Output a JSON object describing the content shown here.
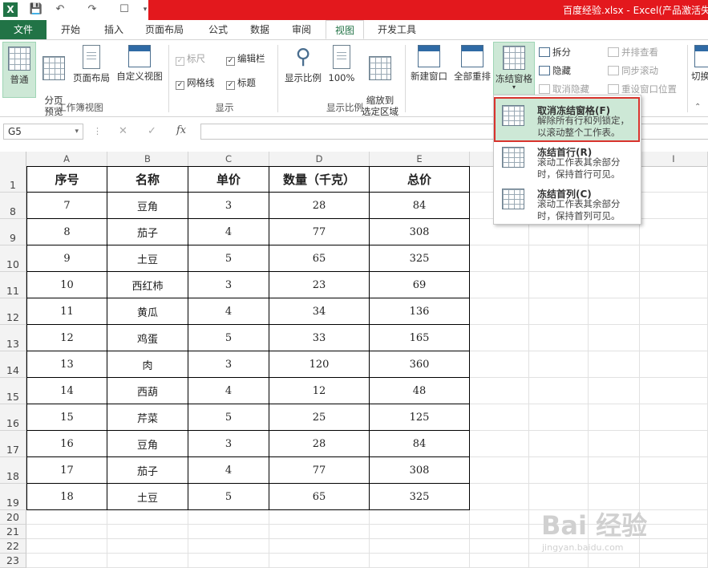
{
  "titlebar": {
    "title": "百度经验.xlsx - Excel(产品激活失",
    "app_icon": "X",
    "accent": "#e3181d"
  },
  "tabs": [
    "文件",
    "开始",
    "插入",
    "页面布局",
    "公式",
    "数据",
    "审阅",
    "视图",
    "开发工具"
  ],
  "active_tab": "视图",
  "ribbon": {
    "workbook_views": {
      "normal": "普通",
      "page_break": "分页\n预览",
      "page_layout": "页面布局",
      "custom_views": "自定义视图",
      "group": "工作簿视图"
    },
    "show": {
      "ruler": "标尺",
      "formula_bar": "编辑栏",
      "gridlines": "网格线",
      "headings": "标题",
      "group": "显示"
    },
    "zoom": {
      "zoom": "显示比例",
      "hundred": "100%",
      "to_selection": "缩放到\n选定区域",
      "group": "显示比例"
    },
    "window": {
      "new_window": "新建窗口",
      "arrange_all": "全部重排",
      "freeze_panes": "冻结窗格",
      "split": "拆分",
      "hide": "隐藏",
      "unhide": "取消隐藏",
      "side_by_side": "并排查看",
      "sync_scroll": "同步滚动",
      "reset_position": "重设窗口位置",
      "switch": "切换"
    }
  },
  "formula_bar": {
    "name_box": "G5",
    "cancel": "✕",
    "enter": "✓",
    "fx": "fx"
  },
  "columns": [
    "A",
    "B",
    "C",
    "D",
    "E",
    "I"
  ],
  "table": {
    "headers": [
      "序号",
      "名称",
      "单价",
      "数量（千克）",
      "总价"
    ],
    "rows": [
      {
        "row": "8",
        "cells": [
          "7",
          "豆角",
          "3",
          "28",
          "84"
        ]
      },
      {
        "row": "9",
        "cells": [
          "8",
          "茄子",
          "4",
          "77",
          "308"
        ]
      },
      {
        "row": "10",
        "cells": [
          "9",
          "土豆",
          "5",
          "65",
          "325"
        ]
      },
      {
        "row": "11",
        "cells": [
          "10",
          "西红柿",
          "3",
          "23",
          "69"
        ]
      },
      {
        "row": "12",
        "cells": [
          "11",
          "黄瓜",
          "4",
          "34",
          "136"
        ]
      },
      {
        "row": "13",
        "cells": [
          "12",
          "鸡蛋",
          "5",
          "33",
          "165"
        ]
      },
      {
        "row": "14",
        "cells": [
          "13",
          "肉",
          "3",
          "120",
          "360"
        ]
      },
      {
        "row": "15",
        "cells": [
          "14",
          "西葫",
          "4",
          "12",
          "48"
        ]
      },
      {
        "row": "16",
        "cells": [
          "15",
          "芹菜",
          "5",
          "25",
          "125"
        ]
      },
      {
        "row": "17",
        "cells": [
          "16",
          "豆角",
          "3",
          "28",
          "84"
        ]
      },
      {
        "row": "18",
        "cells": [
          "17",
          "茄子",
          "4",
          "77",
          "308"
        ]
      },
      {
        "row": "19",
        "cells": [
          "18",
          "土豆",
          "5",
          "65",
          "325"
        ]
      }
    ],
    "header_row": "1",
    "empty_rows": [
      "20",
      "21",
      "22",
      "23"
    ]
  },
  "freeze_menu": [
    {
      "title": "取消冻结窗格(F)",
      "desc": "解除所有行和列锁定，以滚动整个工作表。",
      "selected": true
    },
    {
      "title": "冻结首行(R)",
      "desc": "滚动工作表其余部分时，保持首行可见。",
      "selected": false
    },
    {
      "title": "冻结首列(C)",
      "desc": "滚动工作表其余部分时，保持首列可见。",
      "selected": false
    }
  ],
  "watermark": {
    "logo": "Bai 经验",
    "url": "jingyan.baidu.com"
  }
}
